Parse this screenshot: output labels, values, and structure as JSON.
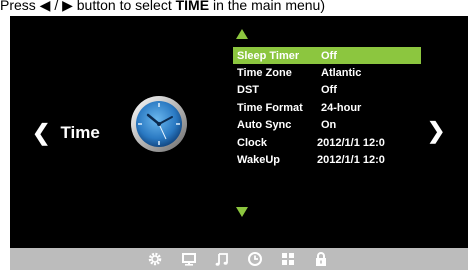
{
  "caption": {
    "part1": "Press ◀ / ▶ button to select ",
    "bold": "TIME",
    "part2": " in the main menu)"
  },
  "category": {
    "label": "Time",
    "icon": "clock-icon"
  },
  "menu": [
    {
      "label": "Sleep Timer",
      "value": "Off",
      "selected": true
    },
    {
      "label": "Time Zone",
      "value": "Atlantic"
    },
    {
      "label": "DST",
      "value": "Off"
    },
    {
      "label": "Time Format",
      "value": "24-hour"
    },
    {
      "label": "Auto Sync",
      "value": "On"
    },
    {
      "label": "Clock",
      "value": "2012/1/1 12:0"
    },
    {
      "label": "WakeUp",
      "value": "2012/1/1 12:0"
    }
  ],
  "colors": {
    "accent": "#8cc63f",
    "background": "#000000",
    "bar": "#bcbcbc"
  },
  "bottom_icons": [
    "settings-icon",
    "display-icon",
    "music-icon",
    "clock-icon",
    "grid-icon",
    "lock-icon"
  ]
}
